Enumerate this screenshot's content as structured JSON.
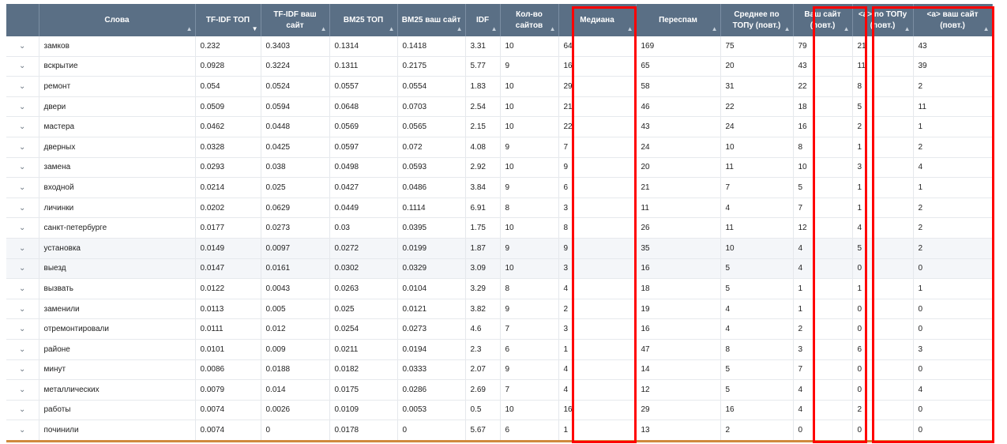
{
  "columns": [
    "Слова",
    "TF-IDF ТОП",
    "TF-IDF ваш сайт",
    "BM25 ТОП",
    "BM25 ваш сайт",
    "IDF",
    "Кол-во сайтов",
    "Медиана",
    "Переспам",
    "Среднее по ТОПу (повт.)",
    "Ваш сайт (повт.)",
    "<a> по ТОПу (повт.)",
    "<a> ваш сайт (повт.)"
  ],
  "expand_glyph": "⌄",
  "sort_glyph": "▲",
  "sort_active_glyph": "▼",
  "rows": [
    [
      "замков",
      "0.232",
      "0.3403",
      "0.1314",
      "0.1418",
      "3.31",
      "10",
      "64",
      "169",
      "75",
      "79",
      "21",
      "43"
    ],
    [
      "вскрытие",
      "0.0928",
      "0.3224",
      "0.1311",
      "0.2175",
      "5.77",
      "9",
      "16",
      "65",
      "20",
      "43",
      "11",
      "39"
    ],
    [
      "ремонт",
      "0.054",
      "0.0524",
      "0.0557",
      "0.0554",
      "1.83",
      "10",
      "29",
      "58",
      "31",
      "22",
      "8",
      "2"
    ],
    [
      "двери",
      "0.0509",
      "0.0594",
      "0.0648",
      "0.0703",
      "2.54",
      "10",
      "21",
      "46",
      "22",
      "18",
      "5",
      "11"
    ],
    [
      "мастера",
      "0.0462",
      "0.0448",
      "0.0569",
      "0.0565",
      "2.15",
      "10",
      "22",
      "43",
      "24",
      "16",
      "2",
      "1"
    ],
    [
      "дверных",
      "0.0328",
      "0.0425",
      "0.0597",
      "0.072",
      "4.08",
      "9",
      "7",
      "24",
      "10",
      "8",
      "1",
      "2"
    ],
    [
      "замена",
      "0.0293",
      "0.038",
      "0.0498",
      "0.0593",
      "2.92",
      "10",
      "9",
      "20",
      "11",
      "10",
      "3",
      "4"
    ],
    [
      "входной",
      "0.0214",
      "0.025",
      "0.0427",
      "0.0486",
      "3.84",
      "9",
      "6",
      "21",
      "7",
      "5",
      "1",
      "1"
    ],
    [
      "личинки",
      "0.0202",
      "0.0629",
      "0.0449",
      "0.1114",
      "6.91",
      "8",
      "3",
      "11",
      "4",
      "7",
      "1",
      "2"
    ],
    [
      "санкт-петербурге",
      "0.0177",
      "0.0273",
      "0.03",
      "0.0395",
      "1.75",
      "10",
      "8",
      "26",
      "11",
      "12",
      "4",
      "2"
    ],
    [
      "установка",
      "0.0149",
      "0.0097",
      "0.0272",
      "0.0199",
      "1.87",
      "9",
      "9",
      "35",
      "10",
      "4",
      "5",
      "2"
    ],
    [
      "выезд",
      "0.0147",
      "0.0161",
      "0.0302",
      "0.0329",
      "3.09",
      "10",
      "3",
      "16",
      "5",
      "4",
      "0",
      "0"
    ],
    [
      "вызвать",
      "0.0122",
      "0.0043",
      "0.0263",
      "0.0104",
      "3.29",
      "8",
      "4",
      "18",
      "5",
      "1",
      "1",
      "1"
    ],
    [
      "заменили",
      "0.0113",
      "0.005",
      "0.025",
      "0.0121",
      "3.82",
      "9",
      "2",
      "19",
      "4",
      "1",
      "0",
      "0"
    ],
    [
      "отремонтировали",
      "0.0111",
      "0.012",
      "0.0254",
      "0.0273",
      "4.6",
      "7",
      "3",
      "16",
      "4",
      "2",
      "0",
      "0"
    ],
    [
      "районе",
      "0.0101",
      "0.009",
      "0.0211",
      "0.0194",
      "2.3",
      "6",
      "1",
      "47",
      "8",
      "3",
      "6",
      "3"
    ],
    [
      "минут",
      "0.0086",
      "0.0188",
      "0.0182",
      "0.0333",
      "2.07",
      "9",
      "4",
      "14",
      "5",
      "7",
      "0",
      "0"
    ],
    [
      "металлических",
      "0.0079",
      "0.014",
      "0.0175",
      "0.0286",
      "2.69",
      "7",
      "4",
      "12",
      "5",
      "4",
      "0",
      "4"
    ],
    [
      "работы",
      "0.0074",
      "0.0026",
      "0.0109",
      "0.0053",
      "0.5",
      "10",
      "16",
      "29",
      "16",
      "4",
      "2",
      "0"
    ],
    [
      "починили",
      "0.0074",
      "0",
      "0.0178",
      "0",
      "5.67",
      "6",
      "1",
      "13",
      "2",
      "0",
      "0",
      "0"
    ]
  ],
  "colors": {
    "header_bg": "#5a6f85",
    "highlight": "#ff0000",
    "bottom_accent": "#d08a3e"
  }
}
